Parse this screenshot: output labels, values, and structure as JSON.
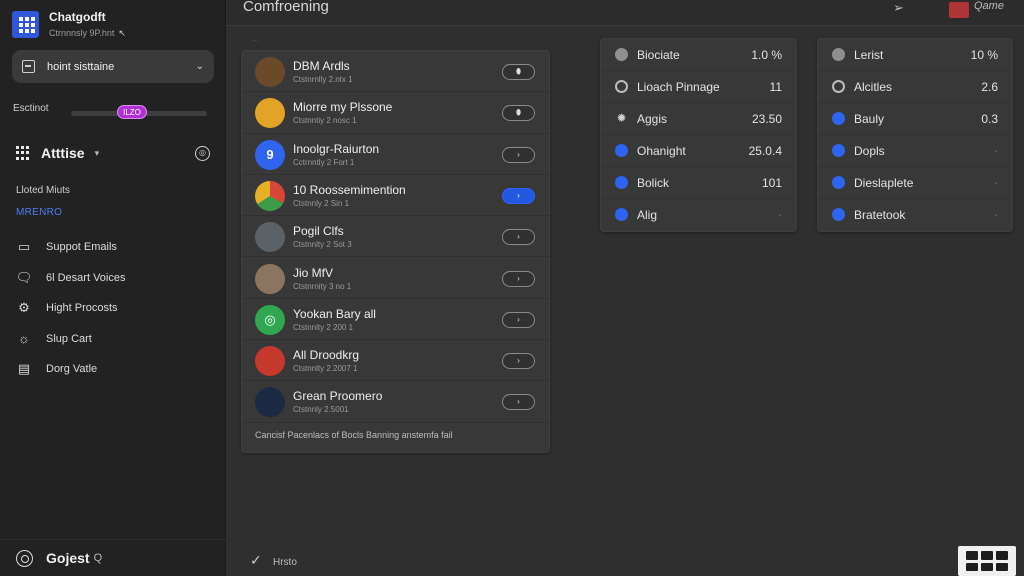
{
  "brand": {
    "title": "Chatgodft",
    "subtitle": "Ctrnnnsly 9P.hnt",
    "cursor": "↖"
  },
  "model_select": {
    "value": "hoint sisttaine",
    "chevron": "⌄"
  },
  "slider": {
    "label": "Esctinot",
    "value_label": "ILZO",
    "level_percent": 78
  },
  "section": {
    "title": "Atttise",
    "chevron": "▾",
    "add": "◎"
  },
  "nav": {
    "caption": "Lloted Miuts",
    "active": "MRENRO",
    "items": [
      {
        "label": "Suppot Emails",
        "icon": "mail-icon"
      },
      {
        "label": "6l Desart Voices",
        "icon": "chat-icon"
      },
      {
        "label": "Hight Procosts",
        "icon": "gear-icon"
      },
      {
        "label": "Slup Cart",
        "icon": "bulb-icon"
      },
      {
        "label": "Dorg Vatle",
        "icon": "document-icon"
      }
    ]
  },
  "sidebar_footer": {
    "label": "Gojest",
    "glyph": "Q"
  },
  "topbar": {
    "title": "Comfroening",
    "right_link": "Qame"
  },
  "contacts": {
    "hint": "...",
    "rows": [
      {
        "name": "DBM Ardls",
        "sub": "Ctstnrnlly 2.ntx 1",
        "avatar_color": "#6b4a2a",
        "avatar_text": "",
        "button": "⬮",
        "active": false
      },
      {
        "name": "Miorre my Plssone",
        "sub": "Ctstnntiy 2 nosc 1",
        "avatar_color": "#e3a326",
        "avatar_text": "",
        "button": "⬮",
        "active": false
      },
      {
        "name": "Inoolgr-Raiurton",
        "sub": "Cctrnntly 2 Fort 1",
        "avatar_color": "#2f64ee",
        "avatar_text": "9",
        "button": "›",
        "active": false
      },
      {
        "name": "10 Roossemimention",
        "sub": "Ctstnnly 2 Sin 1",
        "avatar_color": "#3d9b4a",
        "avatar_text": "",
        "button": "›",
        "active": true
      },
      {
        "name": "Pogil Clfs",
        "sub": "Ctstnnlty 2 Sot 3",
        "avatar_color": "#5a6268",
        "avatar_text": "",
        "button": "›",
        "active": false
      },
      {
        "name": "Jio MfV",
        "sub": "Ctstnrnity 3 no 1",
        "avatar_color": "#8c7560",
        "avatar_text": "",
        "button": "›",
        "active": false
      },
      {
        "name": "Yookan Bary all",
        "sub": "Ctstnnlty 2 200 1",
        "avatar_color": "#2fa84f",
        "avatar_text": "◎",
        "button": "›",
        "active": false
      },
      {
        "name": "All Droodkrg",
        "sub": "Ctstnnlty 2.2007 1",
        "avatar_color": "#c4392b",
        "avatar_text": "",
        "button": "›",
        "active": false
      },
      {
        "name": "Grean Proomero",
        "sub": "Ctstnnly 2.5001",
        "avatar_color": "#1c2a44",
        "avatar_text": "",
        "button": "›",
        "active": false
      }
    ],
    "footer": "Cancisf Pacenlacs of Bocls Banning anstemfa fail"
  },
  "stats_a": [
    {
      "label": "Biociate",
      "value": "1.0 %",
      "icon": "grey"
    },
    {
      "label": "Lioach Pinnage",
      "value": "11",
      "icon": "ring"
    },
    {
      "label": "Aggis",
      "value": "23.50",
      "icon": "star"
    },
    {
      "label": "Ohanight",
      "value": "25.0.4",
      "icon": "blue"
    },
    {
      "label": "Bolick",
      "value": "101",
      "icon": "blue"
    },
    {
      "label": "Alig",
      "value": "-",
      "icon": "blue",
      "dim": true
    }
  ],
  "stats_b": [
    {
      "label": "Lerist",
      "value": "10 %",
      "icon": "grey"
    },
    {
      "label": "Alcitles",
      "value": "2.6",
      "icon": "ring"
    },
    {
      "label": "Bauly",
      "value": "0.3",
      "icon": "blue"
    },
    {
      "label": "Dopls",
      "value": "-",
      "icon": "blue",
      "dim": true
    },
    {
      "label": "Dieslaplete",
      "value": "-",
      "icon": "blue",
      "dim": true
    },
    {
      "label": "Bratetook",
      "value": "-",
      "icon": "blue",
      "dim": true
    }
  ],
  "bottombar": {
    "check": "✓",
    "label": "Hrsto"
  },
  "colors": {
    "accent": "#2f64ee",
    "slider_accent": "#b130d6",
    "background": "#2f2f2f",
    "sidebar": "#222222"
  }
}
